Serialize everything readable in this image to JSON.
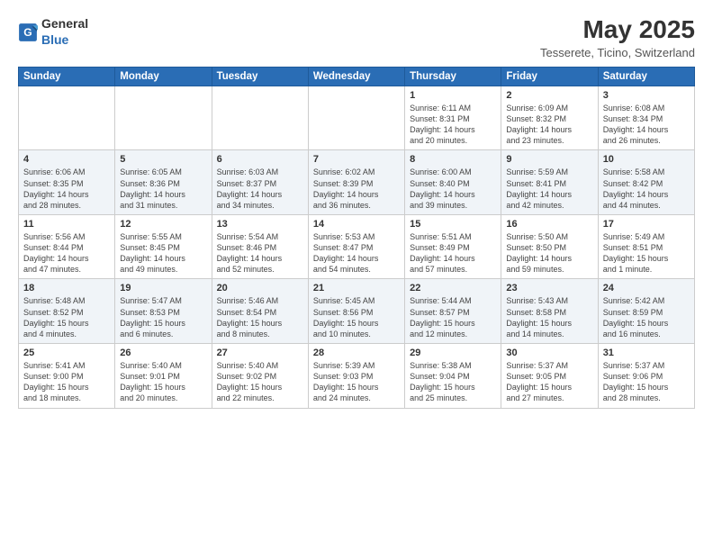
{
  "logo": {
    "general": "General",
    "blue": "Blue"
  },
  "title": "May 2025",
  "subtitle": "Tesserete, Ticino, Switzerland",
  "headers": [
    "Sunday",
    "Monday",
    "Tuesday",
    "Wednesday",
    "Thursday",
    "Friday",
    "Saturday"
  ],
  "weeks": [
    [
      {
        "day": "",
        "info": ""
      },
      {
        "day": "",
        "info": ""
      },
      {
        "day": "",
        "info": ""
      },
      {
        "day": "",
        "info": ""
      },
      {
        "day": "1",
        "info": "Sunrise: 6:11 AM\nSunset: 8:31 PM\nDaylight: 14 hours\nand 20 minutes."
      },
      {
        "day": "2",
        "info": "Sunrise: 6:09 AM\nSunset: 8:32 PM\nDaylight: 14 hours\nand 23 minutes."
      },
      {
        "day": "3",
        "info": "Sunrise: 6:08 AM\nSunset: 8:34 PM\nDaylight: 14 hours\nand 26 minutes."
      }
    ],
    [
      {
        "day": "4",
        "info": "Sunrise: 6:06 AM\nSunset: 8:35 PM\nDaylight: 14 hours\nand 28 minutes."
      },
      {
        "day": "5",
        "info": "Sunrise: 6:05 AM\nSunset: 8:36 PM\nDaylight: 14 hours\nand 31 minutes."
      },
      {
        "day": "6",
        "info": "Sunrise: 6:03 AM\nSunset: 8:37 PM\nDaylight: 14 hours\nand 34 minutes."
      },
      {
        "day": "7",
        "info": "Sunrise: 6:02 AM\nSunset: 8:39 PM\nDaylight: 14 hours\nand 36 minutes."
      },
      {
        "day": "8",
        "info": "Sunrise: 6:00 AM\nSunset: 8:40 PM\nDaylight: 14 hours\nand 39 minutes."
      },
      {
        "day": "9",
        "info": "Sunrise: 5:59 AM\nSunset: 8:41 PM\nDaylight: 14 hours\nand 42 minutes."
      },
      {
        "day": "10",
        "info": "Sunrise: 5:58 AM\nSunset: 8:42 PM\nDaylight: 14 hours\nand 44 minutes."
      }
    ],
    [
      {
        "day": "11",
        "info": "Sunrise: 5:56 AM\nSunset: 8:44 PM\nDaylight: 14 hours\nand 47 minutes."
      },
      {
        "day": "12",
        "info": "Sunrise: 5:55 AM\nSunset: 8:45 PM\nDaylight: 14 hours\nand 49 minutes."
      },
      {
        "day": "13",
        "info": "Sunrise: 5:54 AM\nSunset: 8:46 PM\nDaylight: 14 hours\nand 52 minutes."
      },
      {
        "day": "14",
        "info": "Sunrise: 5:53 AM\nSunset: 8:47 PM\nDaylight: 14 hours\nand 54 minutes."
      },
      {
        "day": "15",
        "info": "Sunrise: 5:51 AM\nSunset: 8:49 PM\nDaylight: 14 hours\nand 57 minutes."
      },
      {
        "day": "16",
        "info": "Sunrise: 5:50 AM\nSunset: 8:50 PM\nDaylight: 14 hours\nand 59 minutes."
      },
      {
        "day": "17",
        "info": "Sunrise: 5:49 AM\nSunset: 8:51 PM\nDaylight: 15 hours\nand 1 minute."
      }
    ],
    [
      {
        "day": "18",
        "info": "Sunrise: 5:48 AM\nSunset: 8:52 PM\nDaylight: 15 hours\nand 4 minutes."
      },
      {
        "day": "19",
        "info": "Sunrise: 5:47 AM\nSunset: 8:53 PM\nDaylight: 15 hours\nand 6 minutes."
      },
      {
        "day": "20",
        "info": "Sunrise: 5:46 AM\nSunset: 8:54 PM\nDaylight: 15 hours\nand 8 minutes."
      },
      {
        "day": "21",
        "info": "Sunrise: 5:45 AM\nSunset: 8:56 PM\nDaylight: 15 hours\nand 10 minutes."
      },
      {
        "day": "22",
        "info": "Sunrise: 5:44 AM\nSunset: 8:57 PM\nDaylight: 15 hours\nand 12 minutes."
      },
      {
        "day": "23",
        "info": "Sunrise: 5:43 AM\nSunset: 8:58 PM\nDaylight: 15 hours\nand 14 minutes."
      },
      {
        "day": "24",
        "info": "Sunrise: 5:42 AM\nSunset: 8:59 PM\nDaylight: 15 hours\nand 16 minutes."
      }
    ],
    [
      {
        "day": "25",
        "info": "Sunrise: 5:41 AM\nSunset: 9:00 PM\nDaylight: 15 hours\nand 18 minutes."
      },
      {
        "day": "26",
        "info": "Sunrise: 5:40 AM\nSunset: 9:01 PM\nDaylight: 15 hours\nand 20 minutes."
      },
      {
        "day": "27",
        "info": "Sunrise: 5:40 AM\nSunset: 9:02 PM\nDaylight: 15 hours\nand 22 minutes."
      },
      {
        "day": "28",
        "info": "Sunrise: 5:39 AM\nSunset: 9:03 PM\nDaylight: 15 hours\nand 24 minutes."
      },
      {
        "day": "29",
        "info": "Sunrise: 5:38 AM\nSunset: 9:04 PM\nDaylight: 15 hours\nand 25 minutes."
      },
      {
        "day": "30",
        "info": "Sunrise: 5:37 AM\nSunset: 9:05 PM\nDaylight: 15 hours\nand 27 minutes."
      },
      {
        "day": "31",
        "info": "Sunrise: 5:37 AM\nSunset: 9:06 PM\nDaylight: 15 hours\nand 28 minutes."
      }
    ]
  ]
}
